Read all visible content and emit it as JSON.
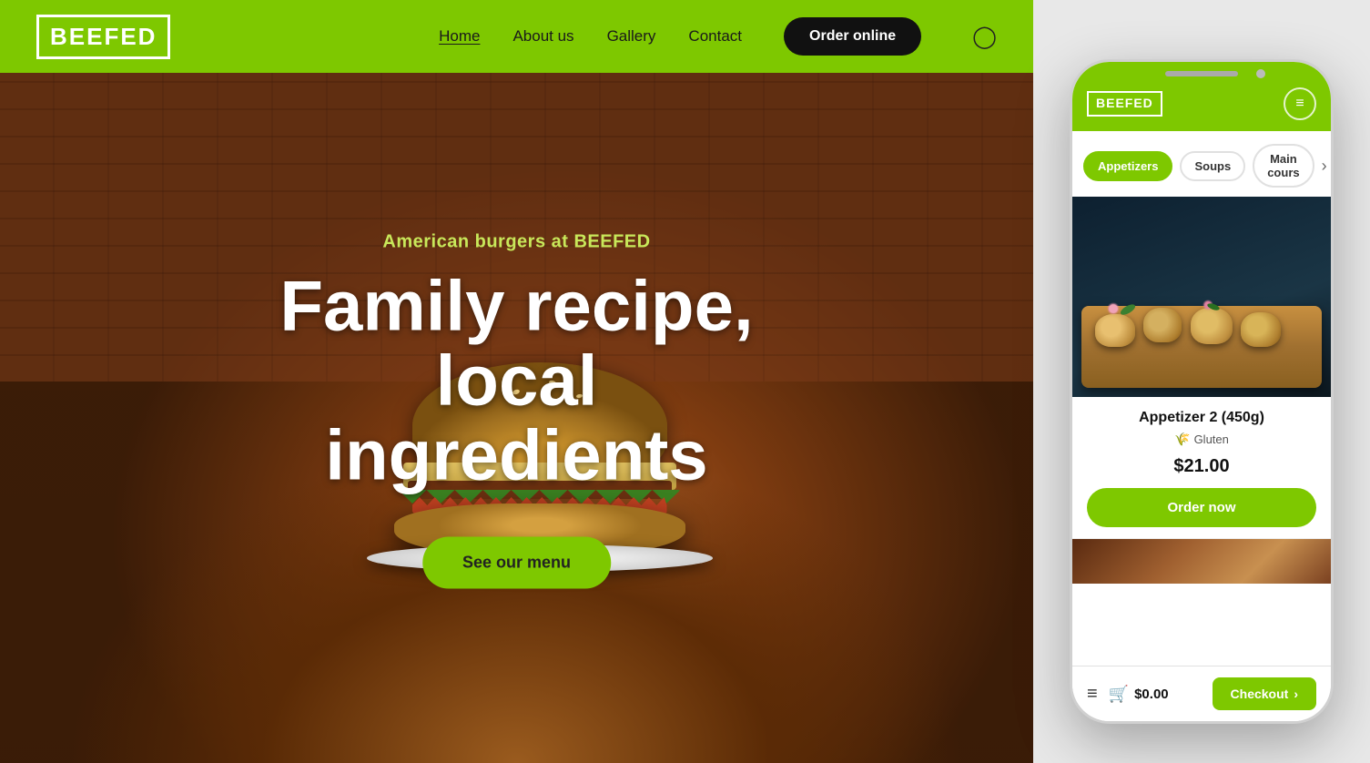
{
  "nav": {
    "logo": "BEEFED",
    "links": [
      {
        "label": "Home",
        "active": true
      },
      {
        "label": "About us",
        "active": false
      },
      {
        "label": "Gallery",
        "active": false
      },
      {
        "label": "Contact",
        "active": false
      }
    ],
    "order_btn": "Order online",
    "user_icon": "👤"
  },
  "hero": {
    "subtitle": "American burgers at BEEFED",
    "title": "Family recipe, local ingredients",
    "cta_btn": "See our menu"
  },
  "phone": {
    "logo": "BEEFED",
    "menu_icon": "≡",
    "tabs": [
      {
        "label": "Appetizers",
        "active": true
      },
      {
        "label": "Soups",
        "active": false
      },
      {
        "label": "Main cours",
        "active": false
      }
    ],
    "food_card": {
      "name": "Appetizer 2 (450g)",
      "tag": "Gluten",
      "tag_icon": "🌾",
      "price": "$21.00",
      "order_btn": "Order now"
    },
    "bottom_bar": {
      "cart_amount": "$0.00",
      "checkout_btn": "Checkout",
      "menu_icon": "≡",
      "cart_icon": "🛒"
    }
  }
}
